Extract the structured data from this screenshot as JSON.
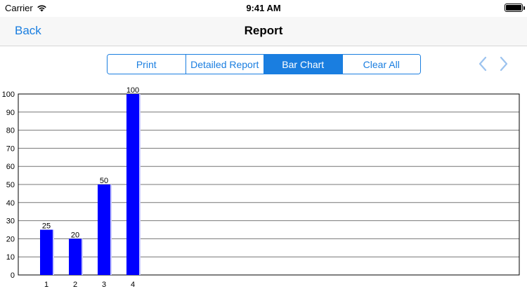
{
  "status": {
    "carrier": "Carrier",
    "time": "9:41 AM"
  },
  "nav": {
    "back_label": "Back",
    "title": "Report"
  },
  "segments": [
    {
      "label": "Print",
      "selected": false
    },
    {
      "label": "Detailed Report",
      "selected": false
    },
    {
      "label": "Bar Chart",
      "selected": true
    },
    {
      "label": "Clear All",
      "selected": false
    }
  ],
  "icons": {
    "prev": "chevron-left-icon",
    "next": "chevron-right-icon",
    "wifi": "wifi-icon",
    "battery": "battery-icon"
  },
  "colors": {
    "accent": "#1a7ee0",
    "bar": "#0000ff",
    "chevron": "#9cc3ef"
  },
  "chart_data": {
    "type": "bar",
    "categories": [
      "1",
      "2",
      "3",
      "4"
    ],
    "values": [
      25,
      20,
      50,
      100
    ],
    "ylim": [
      0,
      100
    ],
    "yticks": [
      0,
      10,
      20,
      30,
      40,
      50,
      60,
      70,
      80,
      90,
      100
    ],
    "grid": true,
    "data_labels": true
  }
}
